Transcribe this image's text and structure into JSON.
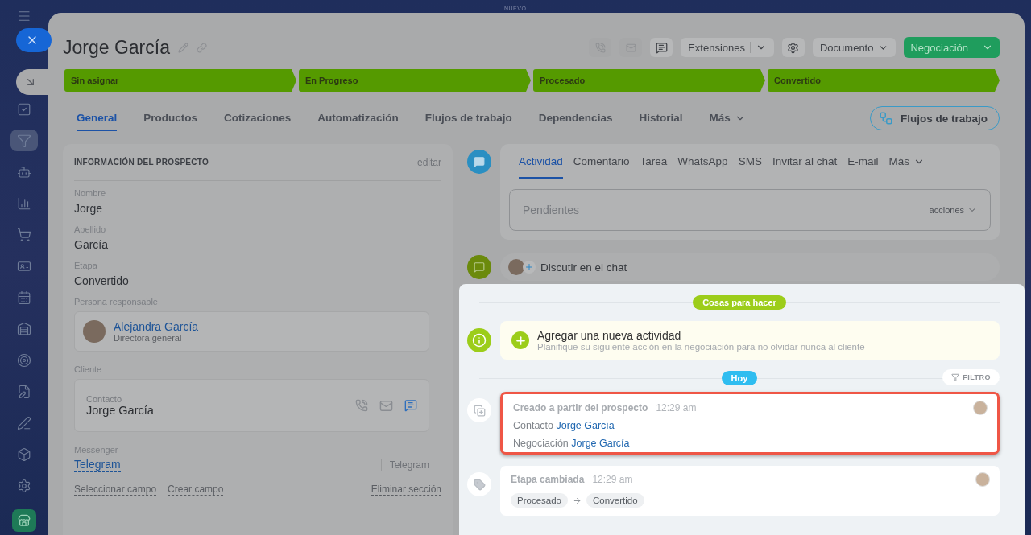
{
  "top_label": "NUEVO",
  "sidebar": {
    "items": [
      {
        "selected": false
      },
      {
        "selected": false
      },
      {
        "selected": true
      },
      {
        "selected": false
      },
      {
        "selected": false
      },
      {
        "selected": false
      },
      {
        "selected": false
      },
      {
        "selected": false
      },
      {
        "selected": false
      },
      {
        "selected": false
      },
      {
        "selected": false
      },
      {
        "selected": false
      },
      {
        "selected": false
      },
      {
        "selected": false
      }
    ]
  },
  "window": {
    "title": "Jorge García"
  },
  "toolbar": {
    "extensions": "Extensiones",
    "document": "Documento",
    "primary": "Negociación"
  },
  "stages": [
    {
      "label": "Sin asignar",
      "done": true
    },
    {
      "label": "En Progreso",
      "done": true
    },
    {
      "label": "Procesado",
      "done": true
    },
    {
      "label": "Convertido",
      "done": true
    }
  ],
  "tabs": [
    {
      "label": "General",
      "selected": true
    },
    {
      "label": "Productos",
      "selected": false
    },
    {
      "label": "Cotizaciones",
      "selected": false
    },
    {
      "label": "Automatización",
      "selected": false
    },
    {
      "label": "Flujos de trabajo",
      "selected": false
    },
    {
      "label": "Dependencias",
      "selected": false
    },
    {
      "label": "Historial",
      "selected": false
    },
    {
      "label": "Más",
      "selected": false,
      "kind": "dropdown"
    }
  ],
  "workflows_button": "Flujos de trabajo",
  "lead_info": {
    "title": "INFORMACIÓN DEL PROSPECTO",
    "edit": "editar",
    "fields": [
      {
        "label": "Nombre",
        "value": "Jorge"
      },
      {
        "label": "Apellido",
        "value": "García"
      },
      {
        "label": "Etapa",
        "value": "Convertido"
      }
    ],
    "responsible": {
      "label": "Persona responsable",
      "name": "Alejandra García",
      "role": "Directora general"
    },
    "client": {
      "label": "Cliente",
      "sub_label": "Contacto",
      "name": "Jorge García"
    },
    "messenger": {
      "label": "Messenger",
      "value": "Telegram",
      "type": "Telegram"
    },
    "footer_links": [
      "Seleccionar campo",
      "Crear campo"
    ],
    "remove": "Eliminar sección"
  },
  "activity": {
    "tabs": [
      {
        "label": "Actividad",
        "selected": true
      },
      {
        "label": "Comentario",
        "selected": false
      },
      {
        "label": "Tarea",
        "selected": false
      },
      {
        "label": "WhatsApp",
        "selected": false
      },
      {
        "label": "SMS",
        "selected": false
      },
      {
        "label": "Invitar al chat",
        "selected": false
      },
      {
        "label": "E-mail",
        "selected": false
      },
      {
        "label": "Más",
        "selected": false,
        "kind": "dropdown"
      }
    ],
    "input": {
      "placeholder": "Pendientes",
      "actions": "acciones"
    }
  },
  "chat": {
    "label": "Discutir en el chat"
  },
  "todo": {
    "badge": "Cosas para hacer",
    "title": "Agregar una nueva actividad",
    "hint": "Planifique su siguiente acción en la negociación para no olvidar nunca al cliente"
  },
  "today": {
    "badge": "Hoy",
    "filter": "FILTRO"
  },
  "events": [
    {
      "kind": "created",
      "title": "Creado a partir del prospecto",
      "time": "12:29 am",
      "highlighted": true,
      "lines": [
        {
          "label": "Contacto",
          "link": "Jorge García"
        },
        {
          "label": "Negociación",
          "link": "Jorge García"
        }
      ]
    },
    {
      "kind": "stage",
      "title": "Etapa cambiada",
      "time": "12:29 am",
      "highlighted": false,
      "from": "Procesado",
      "to": "Convertido"
    }
  ]
}
